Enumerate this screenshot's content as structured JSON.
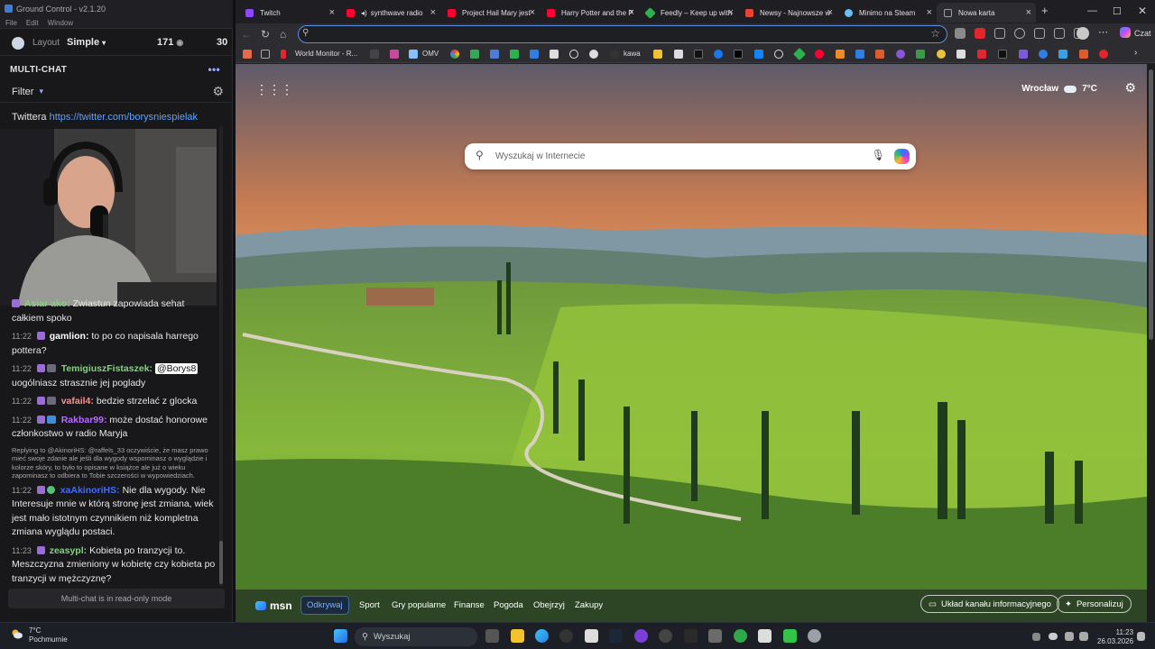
{
  "ground_control": {
    "title": "Ground Control - v2.1.20",
    "menu": [
      "File",
      "Edit",
      "Window"
    ],
    "layout_label": "Layout",
    "layout_value": "Simple",
    "viewer_count": "171",
    "viewer_count_2": "30",
    "multichat_heading": "MULTI-CHAT",
    "filter_label": "Filter",
    "twitter_prefix": "Twittera",
    "twitter_url": "https://twitter.com/borysniespielak",
    "readonly_notice": "Multi-chat is in read-only mode",
    "chat": [
      {
        "time": "",
        "user": "Asiar ako:",
        "user_color": "#7fd67a",
        "text": "Zwiastun zapowiada sehat całkiem spoko"
      },
      {
        "time": "11:22",
        "user": "gamlion:",
        "user_color": "#ffffff",
        "text": "to po co napisala harrego pottera?"
      },
      {
        "time": "11:22",
        "user": "TemigiuszFistaszek:",
        "user_color": "#7fd67a",
        "mention": "@Borys8",
        "text": "uogólniasz strasznie jej poglady"
      },
      {
        "time": "11:22",
        "user": "vafail4:",
        "user_color": "#ff8f8f",
        "text": "bedzie strzelać z glocka"
      },
      {
        "time": "11:22",
        "user": "Rakbar99:",
        "user_color": "#b86cff",
        "text": "może dostać honorowe członkostwo w radio Maryja"
      },
      {
        "time": "11:22",
        "user": "xaAkinoriHS:",
        "user_color": "#3f6cff",
        "reply": "Replying to @AkinoriHS: @raffels_33 oczywiście, że masz prawo mieć swoje zdanie ale jeśli dla wygody wspominasz o wyglądzie i kolorze skóry, to było to opisane w książce ale już o wieku zapominasz to odbiera to Tobie szczerości w wypowiedziach.",
        "text": "Nie dla wygody. Nie Interesuje mnie w którą stronę jest zmiana, wiek jest mało istotnym czynnikiem niż kompletna zmiana wyglądu postaci."
      },
      {
        "time": "11:23",
        "user": "zeasypl:",
        "user_color": "#7fd67a",
        "text": "Kobieta po tranzycji to. Meszczyzna zmieniony w kobietę czy kobieta po tranzycji w mężczyznę?"
      }
    ]
  },
  "browser": {
    "tabs": [
      {
        "label": "Twitch",
        "color": "#9146ff"
      },
      {
        "label": "synthwave radio",
        "color": "#ff0033"
      },
      {
        "label": "Project Hail Mary jest",
        "color": "#ff0033"
      },
      {
        "label": "Harry Potter and the P",
        "color": "#ff0033"
      },
      {
        "label": "Feedly – Keep up with",
        "color": "#2bb24c"
      },
      {
        "label": "Newsy - Najnowsze w",
        "color": "#ea4335"
      },
      {
        "label": "Minimo na Steam",
        "color": "#66c0f4"
      },
      {
        "label": "Nowa karta",
        "color": "#9aa0a6"
      }
    ],
    "address_value": "",
    "czat_label": "Czat",
    "bookmarks": [
      "World Monitor - R...",
      "OMV",
      "kawa"
    ],
    "new_tab": {
      "weather_city": "Wrocław",
      "weather_temp": "7°C",
      "search_placeholder": "Wyszukaj w Internecie",
      "msn_logo": "msn",
      "nav": [
        "Odkrywaj",
        "Sport",
        "Gry popularne",
        "Finanse",
        "Pogoda",
        "Obejrzyj",
        "Zakupy"
      ],
      "feed_layout_button": "Układ kanału informacyjnego",
      "personalize_button": "Personalizuj"
    }
  },
  "taskbar": {
    "weather_temp": "7°C",
    "weather_desc": "Pochmurnie",
    "search_label": "Wyszukaj",
    "time": "11:23",
    "date": "26.03.2026"
  },
  "colors": {
    "accent": "#5b8fe3",
    "twitch": "#9146ff"
  }
}
